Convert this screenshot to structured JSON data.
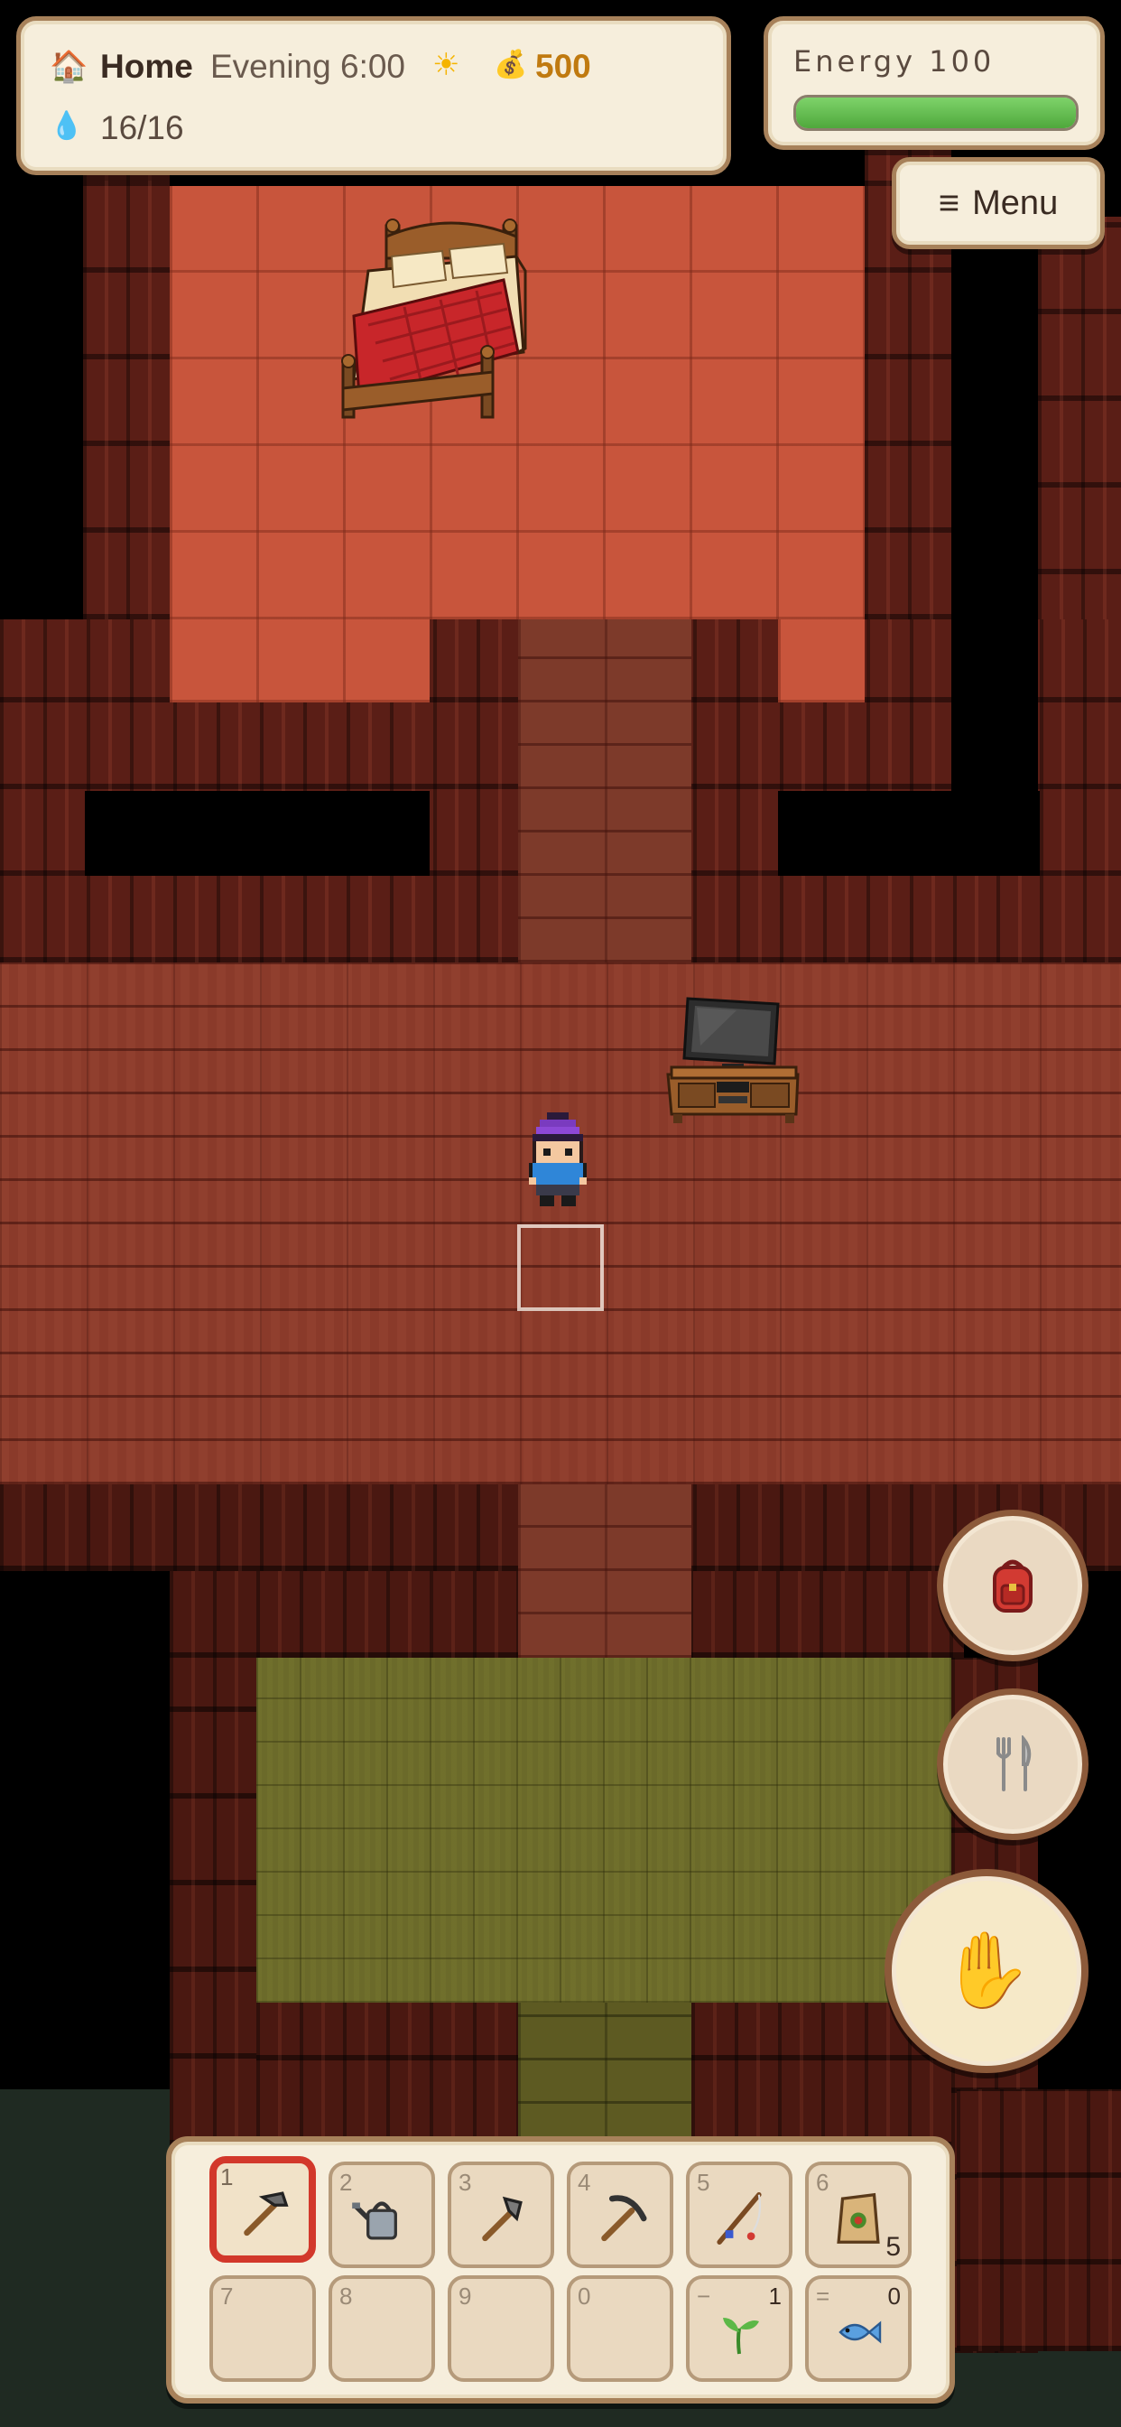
{
  "hud": {
    "location_icon": "house-icon",
    "location": "Home",
    "time": "Evening 6:00",
    "weather_icon": "sun-icon",
    "money_icon": "money-bag-icon",
    "money": "500",
    "water_icon": "water-drop-icon",
    "water": "16/16"
  },
  "energy": {
    "label": "Energy 100",
    "value": 100,
    "max": 100,
    "bar_color": "#5cb847"
  },
  "menu": {
    "icon": "hamburger-icon",
    "label": "Menu"
  },
  "actions": {
    "backpack_icon": "backpack-icon",
    "eat_icon": "fork-knife-icon",
    "interact_icon": "hand-icon"
  },
  "hotbar": {
    "selected_color": "#d2382b",
    "slots": [
      {
        "key": "1",
        "item": "hoe-icon",
        "count": ""
      },
      {
        "key": "2",
        "item": "watering-can-icon",
        "count": ""
      },
      {
        "key": "3",
        "item": "axe-icon",
        "count": ""
      },
      {
        "key": "4",
        "item": "pickaxe-icon",
        "count": ""
      },
      {
        "key": "5",
        "item": "fishing-rod-icon",
        "count": ""
      },
      {
        "key": "6",
        "item": "seed-bag-icon",
        "count": "5"
      },
      {
        "key": "7",
        "item": "",
        "count": ""
      },
      {
        "key": "8",
        "item": "",
        "count": ""
      },
      {
        "key": "9",
        "item": "",
        "count": ""
      },
      {
        "key": "0",
        "item": "",
        "count": ""
      },
      {
        "key": "−",
        "item": "sprout-icon",
        "count": "1"
      },
      {
        "key": "=",
        "item": "fish-icon",
        "count": "0"
      }
    ]
  },
  "scene": {
    "objects": [
      "bed",
      "tv-stand",
      "player-character",
      "tile-selector"
    ]
  }
}
